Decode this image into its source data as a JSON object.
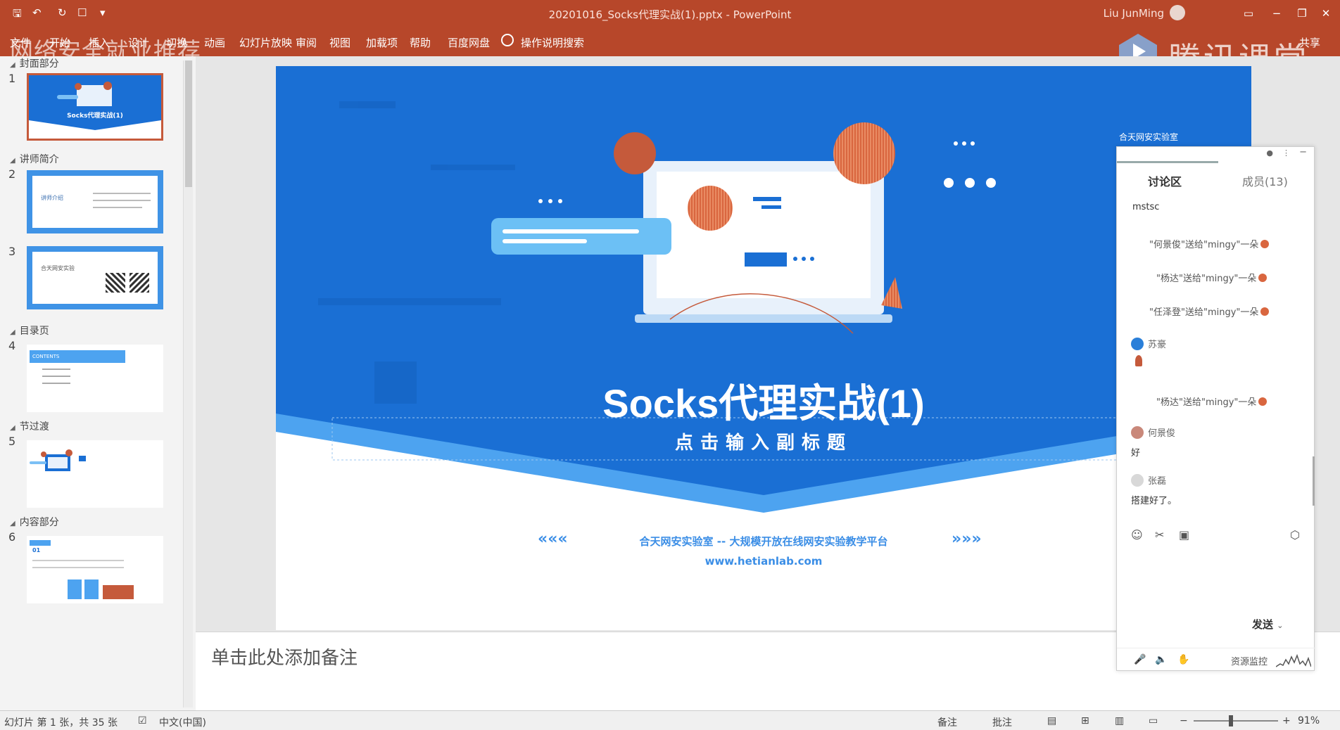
{
  "window": {
    "title": "20201016_Socks代理实战(1).pptx  -  PowerPoint",
    "user": "Liu JunMing"
  },
  "ribbon": {
    "tabs": [
      "文件",
      "开始",
      "插入",
      "设计",
      "切换",
      "动画",
      "幻灯片放映",
      "审阅",
      "视图",
      "加载项",
      "帮助",
      "百度网盘"
    ],
    "search_placeholder": "操作说明搜索",
    "share_label": "共享"
  },
  "overlays": {
    "left_watermark": "网络安全就业推荐",
    "right_watermark": "腾讯课堂"
  },
  "thumbnails": {
    "sections": [
      {
        "label": "封面部分"
      },
      {
        "label": "讲师简介"
      },
      {
        "label": "目录页"
      },
      {
        "label": "节过渡"
      },
      {
        "label": "内容部分"
      }
    ],
    "slide_numbers": [
      "1",
      "2",
      "3",
      "4",
      "5",
      "6"
    ],
    "thumb1_title": "Socks代理实战(1)",
    "thumb2_text": "讲师介绍",
    "thumb3_text": "合天网安实验",
    "thumb4_text": "CONTENTS",
    "thumb6_text": "01"
  },
  "slide": {
    "title": "Socks代理实战(1)",
    "subtitle": "点击输入副标题",
    "footer": "合天网安实验室 -- 大规模开放在线网安实验教学平台",
    "url": "www.hetianlab.com",
    "badge": "合天网安实验室",
    "arrows_left": "«««",
    "arrows_right": "»»»"
  },
  "notes": {
    "placeholder": "单击此处添加备注"
  },
  "chat": {
    "tab_discussion": "讨论区",
    "tab_members": "成员(13)",
    "messages": [
      {
        "text": "mstsc"
      },
      {
        "text": "\"何景俊\"送给\"mingy\"一朵"
      },
      {
        "text": "\"杨达\"送给\"mingy\"一朵"
      },
      {
        "text": "\"任泽登\"送给\"mingy\"一朵"
      },
      {
        "user": "苏豪"
      },
      {
        "text": "\"杨达\"送给\"mingy\"一朵"
      },
      {
        "user": "何景俊",
        "text": "好"
      },
      {
        "user": "张磊",
        "text": "搭建好了。"
      }
    ],
    "send_label": "发送",
    "resource_monitor": "资源监控"
  },
  "statusbar": {
    "slide_info": "幻灯片 第 1 张，共 35 张",
    "language": "中文(中国)",
    "notes_btn": "备注",
    "comments_btn": "批注",
    "zoom": "91%"
  },
  "colors": {
    "ppt_accent": "#b7472a",
    "slide_blue": "#1a6fd4",
    "slide_light_blue": "#4da3f0"
  }
}
